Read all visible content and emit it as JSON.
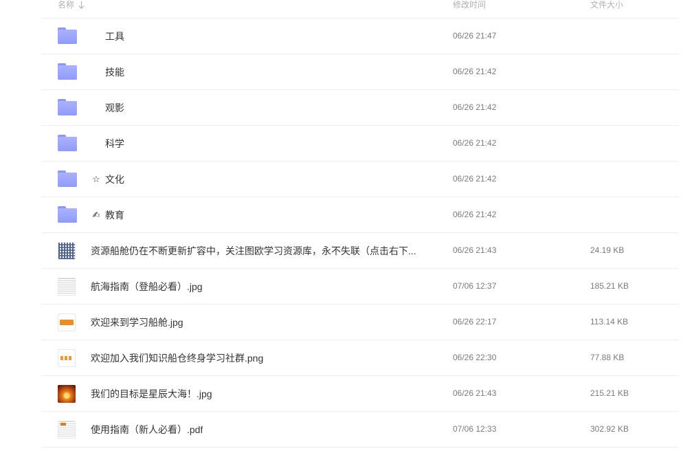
{
  "header": {
    "name_label": "名称",
    "time_label": "修改时间",
    "size_label": "文件大小"
  },
  "rows": [
    {
      "kind": "folder",
      "emoji": "",
      "name": "工具",
      "time": "06/26 21:47",
      "size": ""
    },
    {
      "kind": "folder",
      "emoji": "",
      "name": "技能",
      "time": "06/26 21:42",
      "size": ""
    },
    {
      "kind": "folder",
      "emoji": "",
      "name": "观影",
      "time": "06/26 21:42",
      "size": ""
    },
    {
      "kind": "folder",
      "emoji": "",
      "name": "科学",
      "time": "06/26 21:42",
      "size": ""
    },
    {
      "kind": "folder",
      "emoji": "☆",
      "name": "文化",
      "time": "06/26 21:42",
      "size": ""
    },
    {
      "kind": "folder",
      "emoji": "✍",
      "name": "教育",
      "time": "06/26 21:42",
      "size": ""
    },
    {
      "kind": "image",
      "thumb": "qr-code-thumbnail",
      "name": "资源船舱仍在不断更新扩容中，关注图欧学习资源库，永不失联（点击右下...",
      "time": "06/26 21:43",
      "size": "24.19 KB"
    },
    {
      "kind": "image",
      "thumb": "document-thumbnail",
      "name": "航海指南（登船必看）.jpg",
      "time": "07/06 12:37",
      "size": "185.21 KB"
    },
    {
      "kind": "image",
      "thumb": "orange-logo-thumbnail",
      "name": "欢迎来到学习船舱.jpg",
      "time": "06/26 22:17",
      "size": "113.14 KB"
    },
    {
      "kind": "image",
      "thumb": "text-logo-thumbnail",
      "name": "欢迎加入我们知识船仓终身学习社群.png",
      "time": "06/26 22:30",
      "size": "77.88 KB"
    },
    {
      "kind": "image",
      "thumb": "sunset-thumbnail",
      "name": "我们的目标是星辰大海！.jpg",
      "time": "06/26 21:43",
      "size": "215.21 KB"
    },
    {
      "kind": "pdf",
      "thumb": "pdf-thumbnail",
      "name": "使用指南（新人必看）.pdf",
      "time": "07/06 12:33",
      "size": "302.92 KB"
    }
  ]
}
